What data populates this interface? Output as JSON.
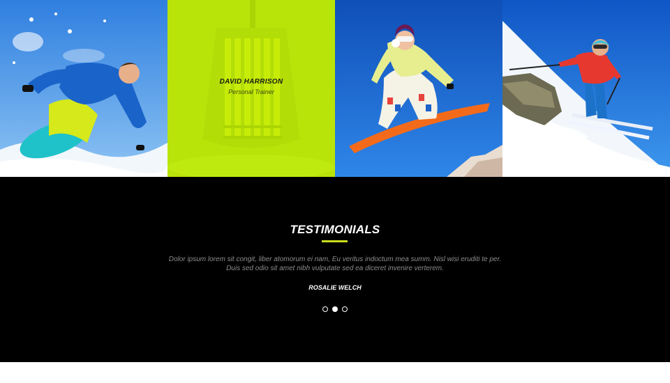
{
  "gallery": {
    "tiles": [
      {
        "image": "snowboarder-carving-photo"
      },
      {
        "image": "ski-gondola-photo",
        "overlay_color": "#ccff00",
        "member": {
          "name": "DAVID HARRISON",
          "role": "Personal Trainer"
        }
      },
      {
        "image": "snowboarder-jumping-photo"
      },
      {
        "image": "skier-downhill-photo"
      }
    ]
  },
  "testimonials": {
    "title": "TESTIMONIALS",
    "accent_color": "#c8dd1e",
    "quote_line1": "Dolor ipsum lorem sit congit, liber atomorum ei nam, Eu veritus indoctum mea summ. Nisl wisi eruditi te per.",
    "quote_line2": "Duis sed odio sit amet nibh vulputate sed ea diceret invenire verterem.",
    "author": "ROSALIE WELCH",
    "pagination": {
      "total": 3,
      "active": 2
    }
  }
}
